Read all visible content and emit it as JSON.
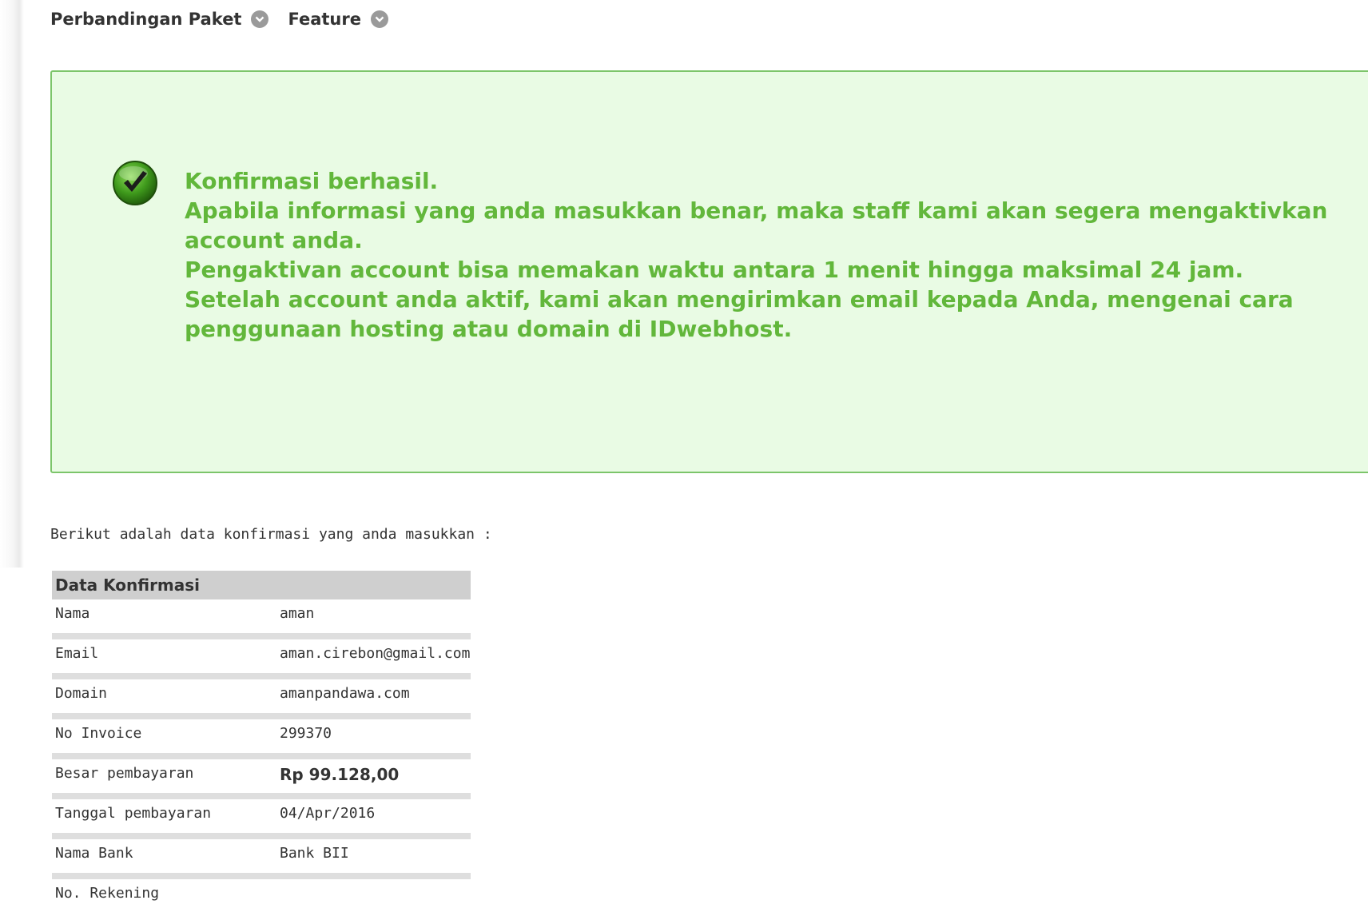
{
  "nav": {
    "items": [
      {
        "label": "Perbandingan Paket"
      },
      {
        "label": "Feature"
      }
    ]
  },
  "alert": {
    "lines": [
      "Konfirmasi berhasil.",
      "Apabila informasi yang anda masukkan benar, maka staff kami akan segera mengaktivkan account anda.",
      "Pengaktivan account bisa memakan waktu antara 1 menit hingga maksimal 24 jam.",
      "Setelah account anda aktif, kami akan mengirimkan email kepada Anda, mengenai cara penggunaan hosting atau domain di IDwebhost."
    ],
    "color": "#62b73b",
    "background": "#e9fbe4"
  },
  "intro_text": "Berikut adalah data konfirmasi yang anda masukkan :",
  "table": {
    "header": "Data Konfirmasi",
    "rows": [
      {
        "label": "Nama",
        "value": "aman"
      },
      {
        "label": "Email",
        "value": "aman.cirebon@gmail.com"
      },
      {
        "label": "Domain",
        "value": "amanpandawa.com"
      },
      {
        "label": "No Invoice",
        "value": "299370"
      },
      {
        "label": "Besar pembayaran",
        "value": "Rp 99.128,00"
      },
      {
        "label": "Tanggal pembayaran",
        "value": "04/Apr/2016"
      },
      {
        "label": "Nama Bank",
        "value": "Bank BII"
      },
      {
        "label": "No. Rekening",
        "value": ""
      }
    ]
  }
}
